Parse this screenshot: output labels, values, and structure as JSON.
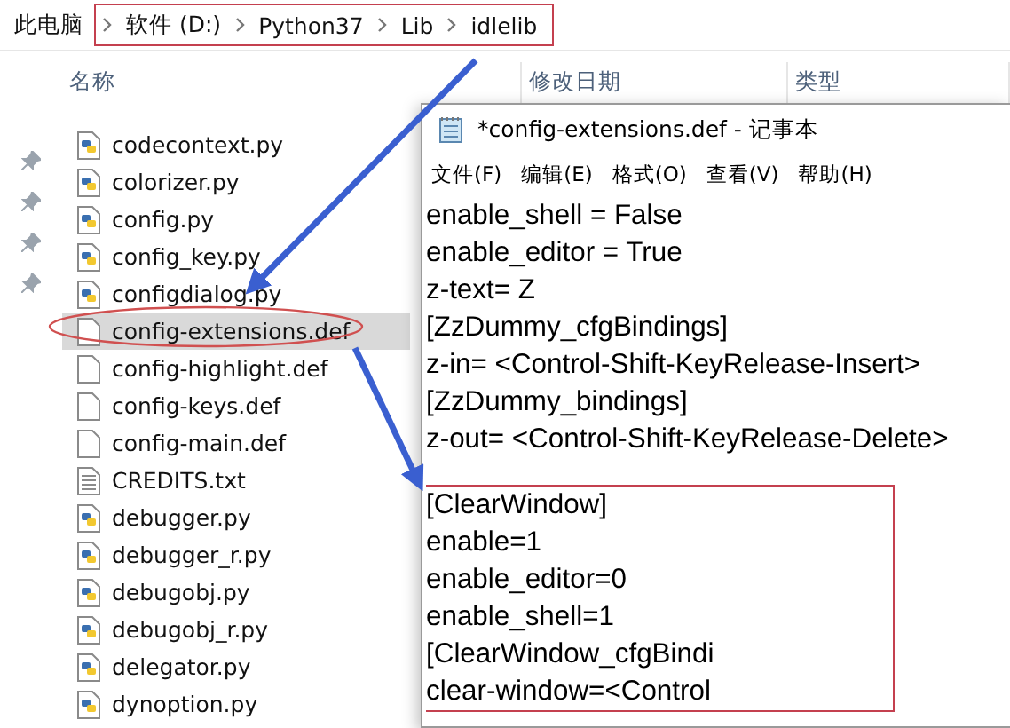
{
  "explorer": {
    "breadcrumb": {
      "root": "此电脑",
      "path": [
        "软件 (D:)",
        "Python37",
        "Lib",
        "idlelib"
      ]
    },
    "columns": [
      "名称",
      "修改日期",
      "类型"
    ],
    "files": [
      {
        "name": "codecontext.py",
        "kind": "python",
        "selected": false
      },
      {
        "name": "colorizer.py",
        "kind": "python",
        "selected": false
      },
      {
        "name": "config.py",
        "kind": "python",
        "selected": false
      },
      {
        "name": "config_key.py",
        "kind": "python",
        "selected": false
      },
      {
        "name": "configdialog.py",
        "kind": "python",
        "selected": false
      },
      {
        "name": "config-extensions.def",
        "kind": "blank",
        "selected": true
      },
      {
        "name": "config-highlight.def",
        "kind": "blank",
        "selected": false
      },
      {
        "name": "config-keys.def",
        "kind": "blank",
        "selected": false
      },
      {
        "name": "config-main.def",
        "kind": "blank",
        "selected": false
      },
      {
        "name": "CREDITS.txt",
        "kind": "text",
        "selected": false
      },
      {
        "name": "debugger.py",
        "kind": "python",
        "selected": false
      },
      {
        "name": "debugger_r.py",
        "kind": "python",
        "selected": false
      },
      {
        "name": "debugobj.py",
        "kind": "python",
        "selected": false
      },
      {
        "name": "debugobj_r.py",
        "kind": "python",
        "selected": false
      },
      {
        "name": "delegator.py",
        "kind": "python",
        "selected": false
      },
      {
        "name": "dynoption.py",
        "kind": "python",
        "selected": false
      }
    ]
  },
  "notepad": {
    "title": "*config-extensions.def - 记事本",
    "menu": [
      "文件(F)",
      "编辑(E)",
      "格式(O)",
      "查看(V)",
      "帮助(H)"
    ],
    "lines": [
      "enable_shell = False",
      "enable_editor = True",
      "z-text= Z",
      "[ZzDummy_cfgBindings]",
      "z-in= <Control-Shift-KeyRelease-Insert>",
      "[ZzDummy_bindings]",
      "z-out= <Control-Shift-KeyRelease-Delete>"
    ],
    "highlighted_lines": [
      "[ClearWindow]",
      "enable=1",
      "enable_editor=0",
      "enable_shell=1",
      "[ClearWindow_cfgBindi",
      "clear-window=<Control"
    ]
  }
}
